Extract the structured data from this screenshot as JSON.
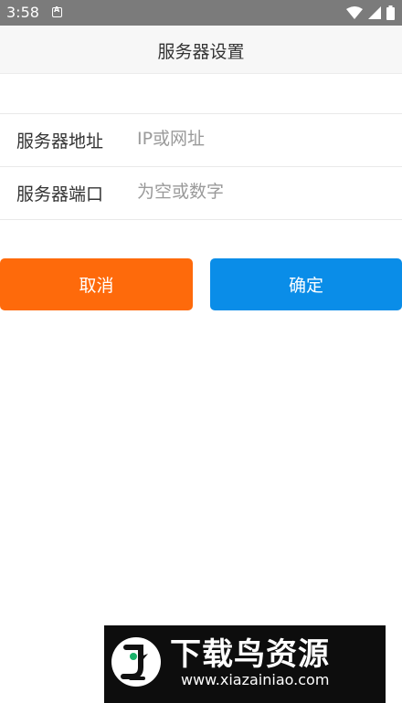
{
  "status_bar": {
    "time": "3:58",
    "icons": [
      "notification-a-icon",
      "wifi-icon",
      "cell-signal-icon",
      "battery-icon"
    ]
  },
  "header": {
    "title": "服务器设置"
  },
  "form": {
    "rows": [
      {
        "label": "服务器地址",
        "value": "",
        "placeholder": "IP或网址"
      },
      {
        "label": "服务器端口",
        "value": "",
        "placeholder": "为空或数字"
      }
    ]
  },
  "buttons": {
    "cancel_label": "取消",
    "confirm_label": "确定"
  },
  "watermark": {
    "title": "下载鸟资源",
    "url": "www.xiazainiao.com"
  },
  "colors": {
    "status_bar": "#7b7b7b",
    "title_bar": "#f7f7f7",
    "cancel": "#fe6a0b",
    "confirm": "#0a8de8",
    "watermark_bg": "#0d0d0d"
  }
}
